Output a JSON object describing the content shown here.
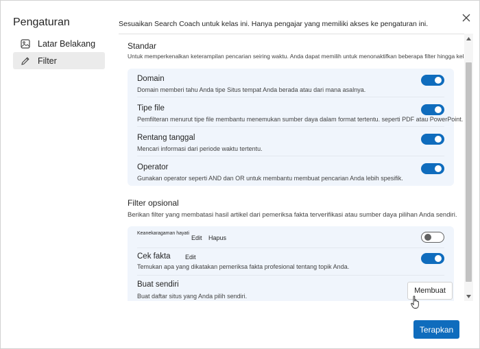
{
  "sidebar": {
    "title": "Pengaturan",
    "items": [
      {
        "label": "Latar Belakang",
        "icon": "image-icon",
        "active": false
      },
      {
        "label": "Filter",
        "icon": "pencil-icon",
        "active": true
      }
    ]
  },
  "header": {
    "description": "Sesuaikan Search Coach untuk kelas ini. Hanya pengajar yang memiliki akses ke pengaturan ini."
  },
  "standard": {
    "title": "Standar",
    "description": "Untuk memperkenalkan keterampilan pencarian seiring waktu. Anda dapat memilih untuk menonaktifkan beberapa filter hingga kelas Anda siap.",
    "rows": [
      {
        "title": "Domain",
        "description": "Domain memberi tahu Anda tipe Situs tempat Anda berada atau dari mana asalnya.",
        "enabled": true
      },
      {
        "title": "Tipe file",
        "description": "Pemfilteran menurut tipe file membantu menemukan sumber daya dalam format tertentu. seperti PDF atau PowerPoint.",
        "enabled": true
      },
      {
        "title": "Rentang tanggal",
        "description": "Mencari informasi dari periode waktu tertentu.",
        "enabled": true
      },
      {
        "title": "Operator",
        "description": "Gunakan operator seperti AND dan OR untuk membantu membuat pencarian Anda lebih spesifik.",
        "enabled": true
      }
    ]
  },
  "optional": {
    "title": "Filter opsional",
    "description": "Berikan filter yang membatasi hasil artikel dari pemeriksa fakta terverifikasi atau sumber daya pilihan Anda sendiri.",
    "rows": [
      {
        "title": "Keanekaragaman hayati",
        "edit_label": "Edit",
        "delete_label": "Hapus",
        "enabled": false
      },
      {
        "title": "Cek fakta",
        "edit_label": "Edit",
        "description": "Temukan apa yang dikatakan pemeriksa fakta profesional tentang topik Anda.",
        "enabled": true
      },
      {
        "title": "Buat sendiri",
        "description": "Buat daftar situs yang Anda pilih sendiri.",
        "button_label": "Membuat"
      }
    ]
  },
  "footer": {
    "apply_label": "Terapkan"
  },
  "colors": {
    "accent": "#0f6cbd",
    "card_bg": "#f0f5fc"
  }
}
